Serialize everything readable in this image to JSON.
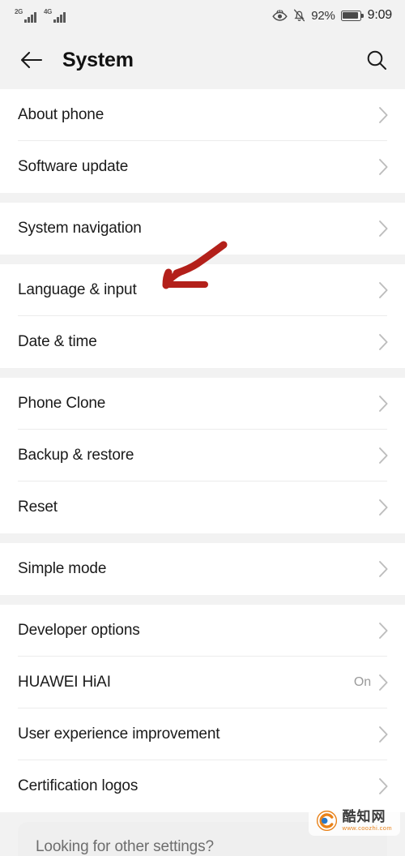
{
  "status_bar": {
    "sim1_network": "2G",
    "sim2_network": "4G",
    "eye_comfort_icon": "eye-comfort-icon",
    "silent_icon": "bell-muted-icon",
    "battery_percent": "92%",
    "battery_icon": "battery-icon",
    "time": "9:09"
  },
  "header": {
    "back_icon": "back-arrow-icon",
    "title": "System",
    "search_icon": "search-icon"
  },
  "groups": [
    {
      "rows": [
        {
          "label": "About phone",
          "value": ""
        },
        {
          "label": "Software update",
          "value": ""
        }
      ]
    },
    {
      "rows": [
        {
          "label": "System navigation",
          "value": ""
        }
      ]
    },
    {
      "rows": [
        {
          "label": "Language & input",
          "value": ""
        },
        {
          "label": "Date & time",
          "value": ""
        }
      ]
    },
    {
      "rows": [
        {
          "label": "Phone Clone",
          "value": ""
        },
        {
          "label": "Backup & restore",
          "value": ""
        },
        {
          "label": "Reset",
          "value": ""
        }
      ]
    },
    {
      "rows": [
        {
          "label": "Simple mode",
          "value": ""
        }
      ]
    },
    {
      "rows": [
        {
          "label": "Developer options",
          "value": ""
        },
        {
          "label": "HUAWEI HiAI",
          "value": "On"
        },
        {
          "label": "User experience improvement",
          "value": ""
        },
        {
          "label": "Certification logos",
          "value": ""
        }
      ]
    }
  ],
  "bottom_card": {
    "text": "Looking for other settings?"
  },
  "annotation": {
    "type": "hand-drawn-arrow",
    "points_to": "Language & input",
    "color": "#b3201a"
  },
  "watermark": {
    "name": "酷知网",
    "url": "www.coozhi.com"
  },
  "colors": {
    "page_bg": "#f2f2f2",
    "row_bg": "#ffffff",
    "text_primary": "#1a1a1a",
    "text_secondary": "#9a9a9a",
    "divider": "#ececec",
    "annotation_red": "#b3201a"
  }
}
